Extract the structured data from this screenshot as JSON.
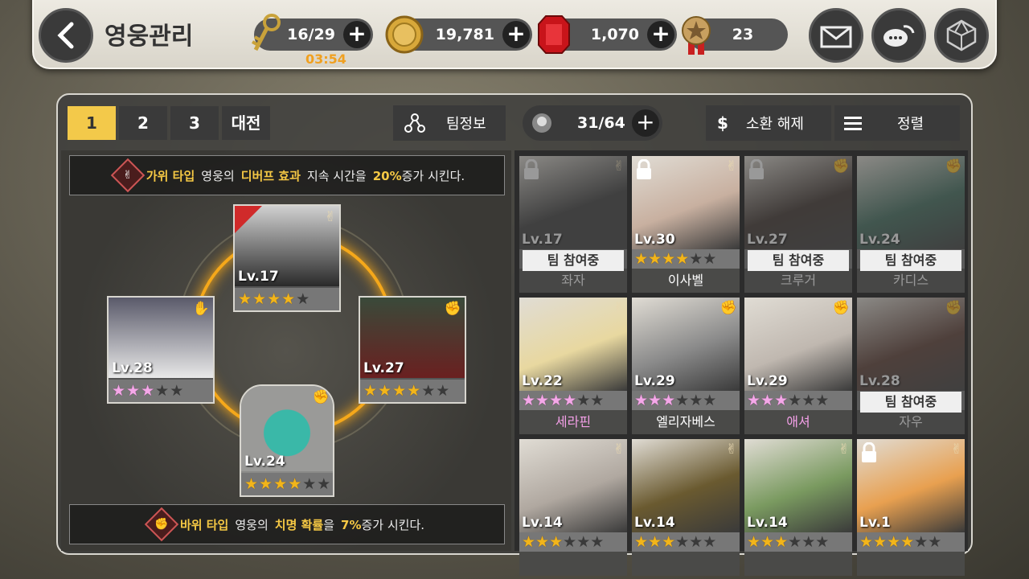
{
  "header": {
    "title": "영웅관리",
    "key": {
      "value": "16/29",
      "timer": "03:54"
    },
    "gold": {
      "value": "19,781"
    },
    "ruby": {
      "value": "1,070"
    },
    "medal": {
      "value": "23"
    }
  },
  "tabs": [
    "1",
    "2",
    "3",
    "대전"
  ],
  "active_tab": "1",
  "team_info_label": "팀정보",
  "hero_count": "31/64",
  "dismiss_label": "소환 해제",
  "dismiss_icon": "$",
  "sort_label": "정렬",
  "buff_top": {
    "pre": "가위 타입",
    "mid": "영웅의",
    "hl": "디버프 효과",
    "mid2": "지속 시간을",
    "pct": "20%",
    "post": "증가 시킨다."
  },
  "buff_bottom": {
    "pre": "바위 타입",
    "mid": "영웅의",
    "hl": "치명 확률",
    "mid2": "을",
    "pct": "7%",
    "post": "증가 시킨다."
  },
  "team": [
    {
      "slot": "top",
      "level": "Lv.17",
      "stars": 5,
      "filled": 4,
      "star_color": "gold",
      "type": "scissors",
      "leader": true
    },
    {
      "slot": "left",
      "level": "Lv.28",
      "stars": 5,
      "filled": 3,
      "star_color": "pink",
      "type": "paper"
    },
    {
      "slot": "right",
      "level": "Lv.27",
      "stars": 6,
      "filled": 4,
      "star_color": "gold",
      "type": "rock"
    },
    {
      "slot": "bottom",
      "level": "Lv.24",
      "stars": 6,
      "filled": 4,
      "star_color": "gold",
      "type": "rock"
    }
  ],
  "team_status_label": "팀 참여중",
  "heroes": [
    {
      "level": "Lv.17",
      "name": "좌자",
      "stars": 4,
      "type": "scissors",
      "in_team": true,
      "locked": true,
      "name_color": "white",
      "portrait": "#3b3b3b"
    },
    {
      "level": "Lv.30",
      "name": "이사벨",
      "stars": 4,
      "type": "scissors",
      "in_team": false,
      "locked": true,
      "name_color": "white",
      "portrait": "#c8b0a0",
      "star_color": "gold"
    },
    {
      "level": "Lv.27",
      "name": "크루거",
      "stars": 4,
      "type": "rock",
      "in_team": true,
      "locked": true,
      "name_color": "white",
      "portrait": "#3a2f2a"
    },
    {
      "level": "Lv.24",
      "name": "카디스",
      "stars": 4,
      "type": "rock",
      "in_team": true,
      "locked": false,
      "name_color": "white",
      "portrait": "#3c6a5a"
    },
    {
      "level": "Lv.22",
      "name": "세라핀",
      "stars": 4,
      "type": "scissors",
      "in_team": false,
      "locked": false,
      "name_color": "pink",
      "portrait": "#e8d8a0",
      "star_color": "pink"
    },
    {
      "level": "Lv.29",
      "name": "엘리자베스",
      "stars": 3,
      "type": "rock",
      "in_team": false,
      "locked": false,
      "name_color": "white",
      "portrait": "#8a8a8a",
      "star_color": "pink"
    },
    {
      "level": "Lv.29",
      "name": "애셔",
      "stars": 3,
      "type": "rock",
      "in_team": false,
      "locked": false,
      "name_color": "pink",
      "portrait": "#c0b8b0",
      "star_color": "pink"
    },
    {
      "level": "Lv.28",
      "name": "자우",
      "stars": 3,
      "type": "rock",
      "in_team": true,
      "locked": false,
      "name_color": "white",
      "portrait": "#5a3a30"
    },
    {
      "level": "Lv.14",
      "name": "",
      "stars": 3,
      "type": "scissors",
      "in_team": false,
      "locked": false,
      "name_color": "white",
      "portrait": "#b0a8a0",
      "star_color": "gold"
    },
    {
      "level": "Lv.14",
      "name": "",
      "stars": 3,
      "type": "scissors",
      "in_team": false,
      "locked": false,
      "name_color": "white",
      "portrait": "#6a5a30",
      "star_color": "gold"
    },
    {
      "level": "Lv.14",
      "name": "",
      "stars": 3,
      "type": "scissors",
      "in_team": false,
      "locked": false,
      "name_color": "white",
      "portrait": "#7a9a60",
      "star_color": "gold"
    },
    {
      "level": "Lv.1",
      "name": "",
      "stars": 4,
      "type": "scissors",
      "in_team": false,
      "locked": true,
      "name_color": "white",
      "portrait": "#e8a050",
      "star_color": "gold"
    }
  ],
  "type_icons": {
    "scissors": "✌",
    "rock": "✊",
    "paper": "✋"
  },
  "colors": {
    "accent": "#f3c94a",
    "ring": "#f5a81a",
    "rock": "#d02a2a",
    "paper": "#6a9ae8",
    "scissors": "#e8d8b0"
  }
}
